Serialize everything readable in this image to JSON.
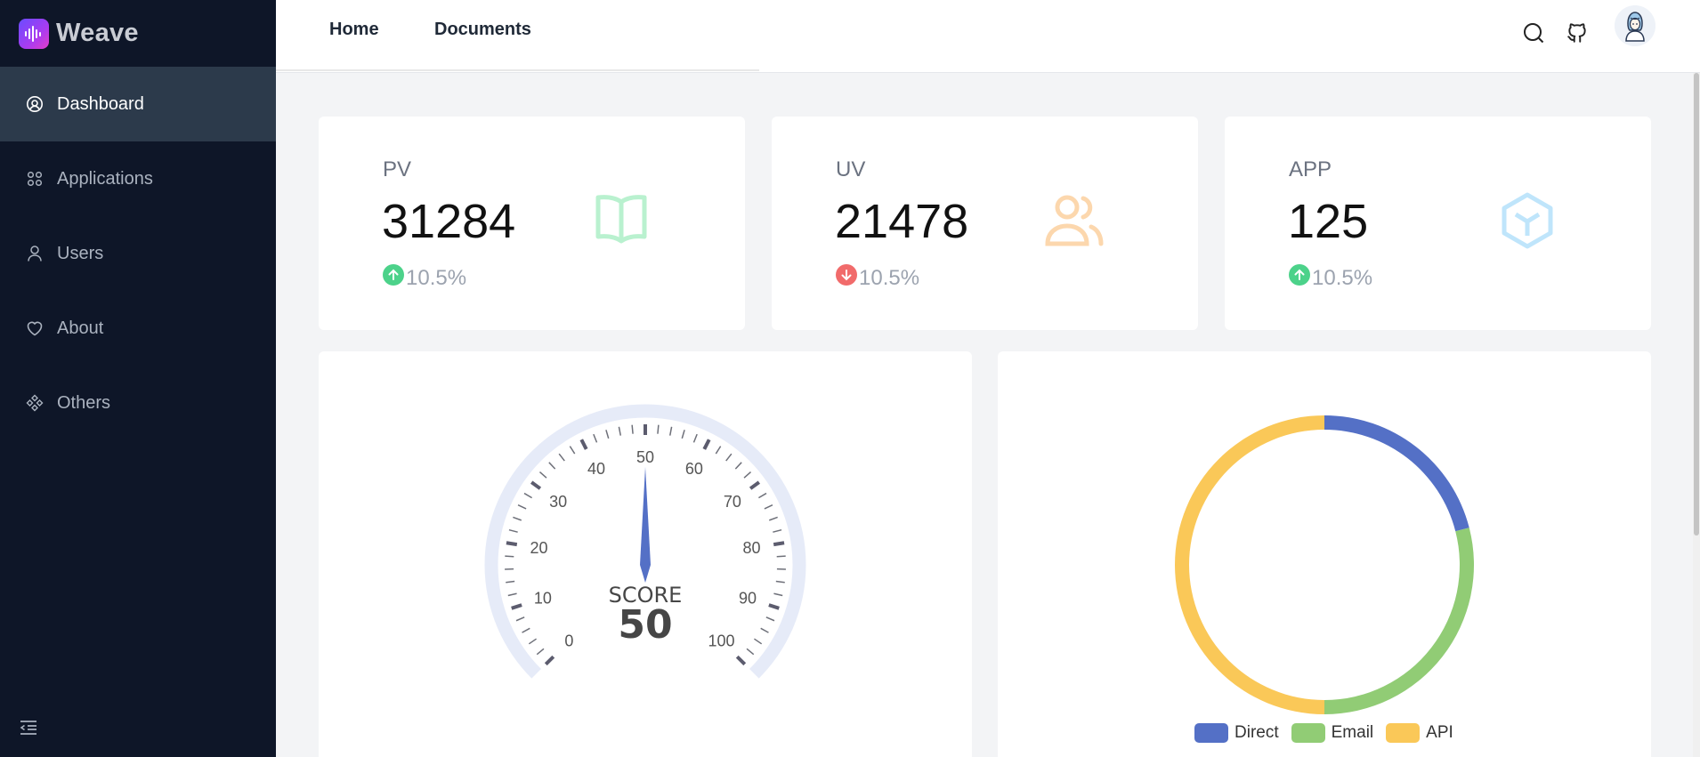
{
  "app": {
    "name": "Weave",
    "logo_icon": "sound-wave-logo-icon"
  },
  "sidebar": {
    "items": [
      {
        "label": "Dashboard",
        "icon": "dashboard-icon",
        "active": true
      },
      {
        "label": "Applications",
        "icon": "apps-grid-icon",
        "active": false
      },
      {
        "label": "Users",
        "icon": "user-icon",
        "active": false
      },
      {
        "label": "About",
        "icon": "heart-icon",
        "active": false
      },
      {
        "label": "Others",
        "icon": "diamond-cluster-icon",
        "active": false
      }
    ],
    "collapse_icon": "menu-fold-icon"
  },
  "header": {
    "tabs": [
      {
        "label": "Home"
      },
      {
        "label": "Documents"
      }
    ],
    "icons": [
      "search-icon",
      "github-icon"
    ],
    "avatar": "user-avatar"
  },
  "stats": [
    {
      "label": "PV",
      "value": "31284",
      "change": "10.5%",
      "direction": "up",
      "icon": "book-icon",
      "icon_color": "#b9f1cf"
    },
    {
      "label": "UV",
      "value": "21478",
      "change": "10.5%",
      "direction": "down",
      "icon": "users-icon",
      "icon_color": "#fcd7ad"
    },
    {
      "label": "APP",
      "value": "125",
      "change": "10.5%",
      "direction": "up",
      "icon": "cube-icon",
      "icon_color": "#bfe5fb"
    }
  ],
  "trend_colors": {
    "up": "#4cd28a",
    "down": "#f16b6b"
  },
  "gauge": {
    "title": "SCORE",
    "value": 50,
    "min": 0,
    "max": 100,
    "ticks": [
      "0",
      "10",
      "20",
      "30",
      "40",
      "50",
      "60",
      "70",
      "80",
      "90",
      "100"
    ],
    "pointer_color": "#5470c6",
    "track_color": "#e6ebf8"
  },
  "chart_data": {
    "type": "pie",
    "subtype": "donut",
    "series": [
      {
        "name": "Direct",
        "value": 21,
        "color": "#5470c6"
      },
      {
        "name": "Email",
        "value": 29,
        "color": "#91cc75"
      },
      {
        "name": "API",
        "value": 50,
        "color": "#fac858"
      }
    ],
    "legend": "bottom-center"
  }
}
